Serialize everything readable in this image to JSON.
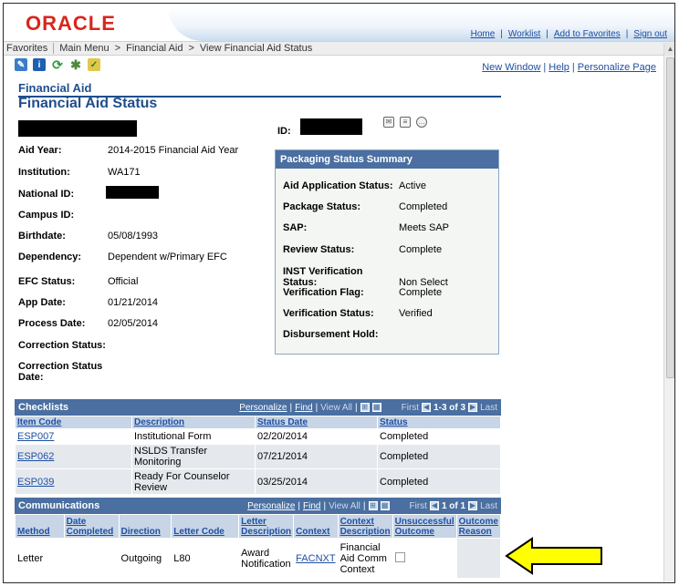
{
  "header": {
    "logo": "ORACLE",
    "links": [
      "Home",
      "Worklist",
      "Add to Favorites",
      "Sign out"
    ]
  },
  "breadcrumb": {
    "items": [
      "Favorites",
      "Main Menu",
      "Financial Aid",
      "View Financial Aid Status"
    ],
    "separators": [
      ">",
      ">"
    ]
  },
  "toolbar_icons": [
    "pen-icon",
    "info-icon",
    "refresh-icon",
    "gear-icon",
    "edit-page-icon"
  ],
  "right_links": [
    "New Window",
    "Help",
    "Personalize Page"
  ],
  "section_title": "Financial Aid",
  "page_title": "Financial Aid Status",
  "id_label": "ID:",
  "fields": {
    "aid_year": {
      "label": "Aid Year:",
      "value": "2014-2015 Financial Aid Year"
    },
    "institution": {
      "label": "Institution:",
      "value": "WA171"
    },
    "national_id": {
      "label": "National ID:",
      "value": ""
    },
    "campus_id": {
      "label": "Campus ID:",
      "value": ""
    },
    "birthdate": {
      "label": "Birthdate:",
      "value": "05/08/1993"
    },
    "dependency": {
      "label": "Dependency:",
      "value": "Dependent w/Primary EFC"
    },
    "efc_status": {
      "label": "EFC Status:",
      "value": "Official"
    },
    "app_date": {
      "label": "App Date:",
      "value": "01/21/2014"
    },
    "process_date": {
      "label": "Process Date:",
      "value": "02/05/2014"
    },
    "correction_status": {
      "label": "Correction Status:",
      "value": ""
    },
    "correction_status_date_1": "Correction Status",
    "correction_status_date_2": "Date:"
  },
  "packaging": {
    "title": "Packaging Status Summary",
    "rows": [
      {
        "label": "Aid Application Status:",
        "value": "Active"
      },
      {
        "label": "Package Status:",
        "value": "Completed"
      },
      {
        "label": "SAP:",
        "value": "Meets SAP"
      },
      {
        "label": "Review Status:",
        "value": "Complete"
      },
      {
        "label": "INST Verification Status:",
        "value": "Non Select"
      },
      {
        "label": "Verification Flag:",
        "value": "Complete"
      },
      {
        "label": "Verification Status:",
        "value": "Verified"
      },
      {
        "label": "Disbursement Hold:",
        "value": ""
      }
    ]
  },
  "checklists": {
    "title": "Checklists",
    "personalize": "Personalize",
    "find": "Find",
    "view_all": "View All",
    "first": "First",
    "range": "1-3 of 3",
    "last": "Last",
    "columns": [
      "Item Code",
      "Description",
      "Status Date",
      "Status"
    ],
    "rows": [
      [
        "ESP007",
        "Institutional Form",
        "02/20/2014",
        "Completed"
      ],
      [
        "ESP062",
        "NSLDS Transfer Monitoring",
        "07/21/2014",
        "Completed"
      ],
      [
        "ESP039",
        "Ready For Counselor Review",
        "03/25/2014",
        "Completed"
      ]
    ]
  },
  "communications": {
    "title": "Communications",
    "personalize": "Personalize",
    "find": "Find",
    "view_all": "View All",
    "first": "First",
    "range": "1 of 1",
    "last": "Last",
    "columns": [
      "Method",
      "Date Completed",
      "Direction",
      "Letter Code",
      "Letter Description",
      "Context",
      "Context Description",
      "Unsuccessful Outcome",
      "Outcome Reason"
    ],
    "rows": [
      [
        "Letter",
        "",
        "Outgoing",
        "L80",
        "Award Notification",
        "FACNXT",
        "Financial Aid Comm Context",
        "",
        ""
      ]
    ]
  },
  "colors": {
    "oracle_red": "#d8261c",
    "title_blue": "#1f4e8c",
    "grid_header": "#4a6fa0",
    "arrow_fill": "#ffff00"
  }
}
